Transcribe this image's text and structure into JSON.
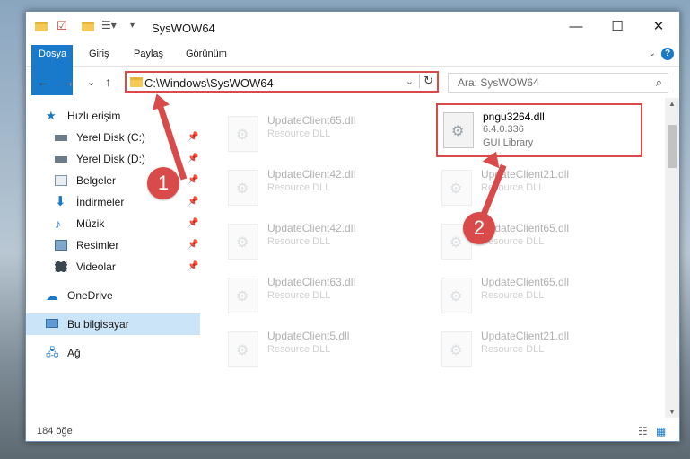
{
  "window": {
    "title": "SysWOW64",
    "controls": {
      "minimize": "—",
      "maximize": "☐",
      "close": "✕"
    }
  },
  "ribbon": {
    "tabs": [
      "Dosya",
      "Giriş",
      "Paylaş",
      "Görünüm"
    ],
    "help": "?"
  },
  "nav": {
    "back": "←",
    "forward": "→",
    "recent": "⌄",
    "up": "↑",
    "address": "C:\\Windows\\SysWOW64",
    "search_placeholder": "Ara: SysWOW64"
  },
  "sidebar": {
    "quick_access": "Hızlı erişim",
    "items": [
      {
        "label": "Yerel Disk (C:)",
        "icon": "drive-icon"
      },
      {
        "label": "Yerel Disk (D:)",
        "icon": "drive-icon"
      },
      {
        "label": "Belgeler",
        "icon": "documents-icon"
      },
      {
        "label": "İndirmeler",
        "icon": "download-icon"
      },
      {
        "label": "Müzik",
        "icon": "music-icon"
      },
      {
        "label": "Resimler",
        "icon": "pictures-icon"
      },
      {
        "label": "Videolar",
        "icon": "videos-icon"
      }
    ],
    "onedrive": "OneDrive",
    "this_pc": "Bu bilgisayar",
    "network": "Ağ"
  },
  "files": [
    {
      "name": "UpdateClient65.dll",
      "desc": "Resource DLL"
    },
    {
      "name": "pngu3264.dll",
      "version": "6.4.0.336",
      "desc": "GUI Library"
    },
    {
      "name": "UpdateClient42.dll",
      "desc": "Resource DLL"
    },
    {
      "name": "UpdateClient21.dll",
      "desc": "Resource DLL"
    },
    {
      "name": "UpdateClient42.dll",
      "desc": "Resource DLL"
    },
    {
      "name": "UpdateClient65.dll",
      "desc": "Resource DLL"
    },
    {
      "name": "UpdateClient63.dll",
      "desc": "Resource DLL"
    },
    {
      "name": "UpdateClient65.dll",
      "desc": "Resource DLL"
    },
    {
      "name": "UpdateClient5.dll",
      "desc": "Resource DLL"
    },
    {
      "name": "UpdateClient21.dll",
      "desc": "Resource DLL"
    }
  ],
  "status": {
    "count": "184 öğe"
  },
  "annotations": {
    "badge1": "1",
    "badge2": "2"
  },
  "colors": {
    "accent": "#1979ca",
    "highlight": "#d94a4a",
    "selected": "#cce4f7"
  }
}
